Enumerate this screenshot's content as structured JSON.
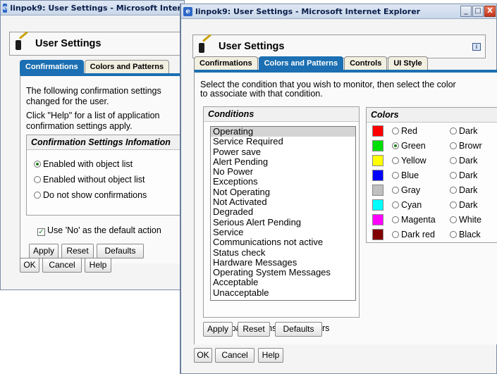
{
  "back_window": {
    "title": "linpok9: User Settings - Microsoft Internet Explorer",
    "header_title": "User Settings",
    "tabs": [
      {
        "label": "Confirmations"
      },
      {
        "label": "Colors and Patterns"
      }
    ],
    "intro_line1": "The following confirmation settings",
    "intro_line2": "changed for the user.",
    "help_line1": "Click \"Help\" for a list of application",
    "help_line2": "confirmation settings apply.",
    "group_title": "Confirmation Settings Infomation",
    "radio_options": [
      {
        "label": "Enabled with object list",
        "selected": true
      },
      {
        "label": "Enabled without object list",
        "selected": false
      },
      {
        "label": "Do not show confirmations",
        "selected": false
      }
    ],
    "checkbox_label": "Use 'No' as the default action",
    "buttons": {
      "apply": "Apply",
      "reset": "Reset",
      "defaults": "Defaults"
    },
    "footer": {
      "ok": "OK",
      "cancel": "Cancel",
      "help": "Help"
    }
  },
  "front_window": {
    "title": "linpok9: User Settings - Microsoft Internet Explorer",
    "title_controls": {
      "minimize": "_",
      "maximize": "□",
      "close": "X"
    },
    "header_title": "User Settings",
    "info_icon": "i",
    "tabs": [
      {
        "label": "Confirmations",
        "active": false
      },
      {
        "label": "Colors and Patterns",
        "active": true
      },
      {
        "label": "Controls",
        "active": false
      },
      {
        "label": "UI Style",
        "active": false
      }
    ],
    "instruction_line1": "Select the condition that you wish to monitor, then select the color",
    "instruction_line2": "to associate with that condition.",
    "conditions_header": "Conditions",
    "conditions": [
      "Operating",
      "Service Required",
      "Power save",
      "Alert Pending",
      "No Power",
      "Exceptions",
      "Not Operating",
      "Not Activated",
      "Degraded",
      "Serious Alert Pending",
      "Service",
      "Communications not active",
      "Status check",
      "Hardware Messages",
      "Operating System Messages",
      "Acceptable",
      "Unacceptable"
    ],
    "selected_condition": "Operating",
    "colors_header": "Colors",
    "colors": [
      {
        "label": "Red",
        "swatch": "#ff0000",
        "selected": false,
        "alt_label": "Dark"
      },
      {
        "label": "Green",
        "swatch": "#00e000",
        "selected": true,
        "alt_label": "Browr"
      },
      {
        "label": "Yellow",
        "swatch": "#ffff00",
        "selected": false,
        "alt_label": "Dark"
      },
      {
        "label": "Blue",
        "swatch": "#0000ff",
        "selected": false,
        "alt_label": "Dark"
      },
      {
        "label": "Gray",
        "swatch": "#c0c0c0",
        "selected": false,
        "alt_label": "Dark"
      },
      {
        "label": "Cyan",
        "swatch": "#00ffff",
        "selected": false,
        "alt_label": "Dark"
      },
      {
        "label": "Magenta",
        "swatch": "#ff00ff",
        "selected": false,
        "alt_label": "White"
      },
      {
        "label": "Dark red",
        "swatch": "#800000",
        "selected": false,
        "alt_label": "Black"
      }
    ],
    "patterns_checkbox": "Use patterns instead of colors",
    "buttons": {
      "apply": "Apply",
      "reset": "Reset",
      "defaults": "Defaults"
    },
    "footer": {
      "ok": "OK",
      "cancel": "Cancel",
      "help": "Help"
    }
  },
  "accent_color": "#1b6fb2"
}
